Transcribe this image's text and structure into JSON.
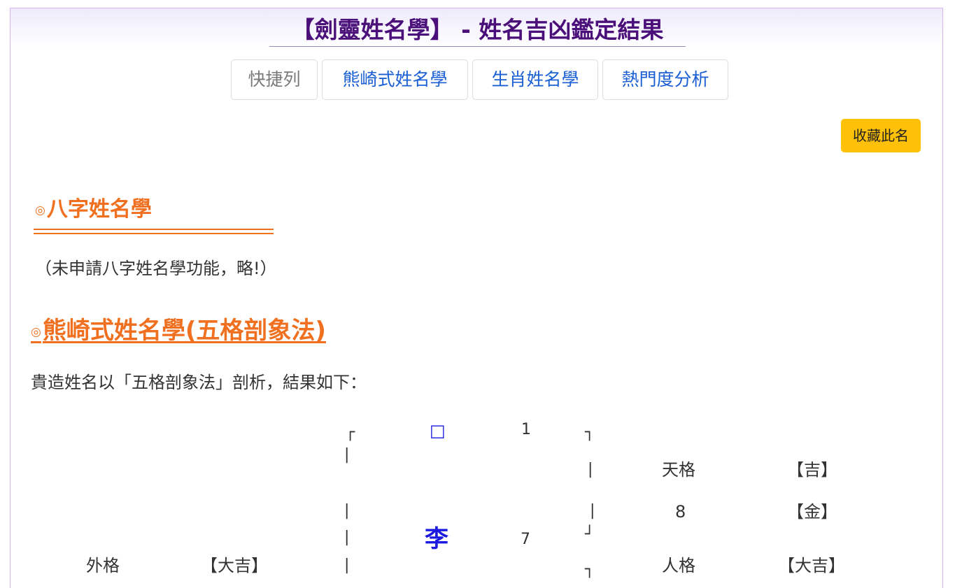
{
  "title": "【劍靈姓名學】 - 姓名吉凶鑑定結果",
  "nav": {
    "shortcut": "快捷列",
    "kumazaki": "熊崎式姓名學",
    "zodiac": "生肖姓名學",
    "popularity": "熱門度分析"
  },
  "favorite_label": "收藏此名",
  "section_bazi": {
    "mark": "◎",
    "title": "八字姓名學",
    "note": "（未申請八字姓名學功能，略!）"
  },
  "section_kumazaki": {
    "mark": "◎",
    "title": "熊崎式姓名學(五格剖象法)",
    "intro": "貴造姓名以「五格剖象法」剖析，結果如下："
  },
  "diagram": {
    "bracket_top_left": "┌",
    "bracket_top_right": "┐",
    "bracket_bottom_right": "┘",
    "bar": "|",
    "placeholder_char": "□",
    "placeholder_strokes": "1",
    "surname_char": "李",
    "surname_strokes": "7",
    "heaven_label": "天格",
    "heaven_result": "【吉】",
    "heaven_value": "8",
    "heaven_element": "【金】",
    "outer_label": "外格",
    "outer_result": "【大吉】",
    "person_label": "人格",
    "person_result": "【大吉】"
  },
  "colors": {
    "title": "#4b0f7a",
    "section": "#f07020",
    "link": "#1a5fd4",
    "favorite_bg": "#ffc107",
    "diagram_char": "#1a1ae0"
  }
}
